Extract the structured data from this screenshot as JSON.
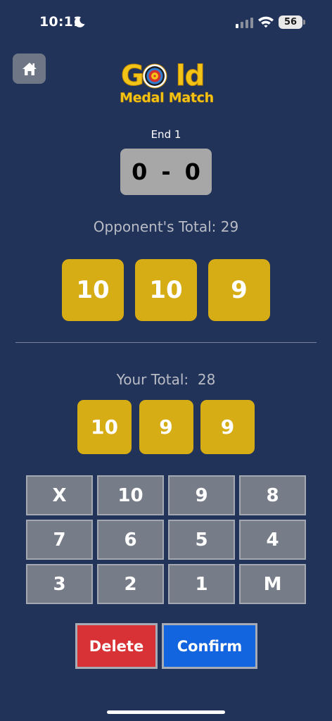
{
  "status_bar": {
    "time": "10:11",
    "battery": "56"
  },
  "logo": {
    "line1_a": "G",
    "line1_b": "ld",
    "line2": "Medal Match"
  },
  "match": {
    "end_label": "End 1",
    "score_left": "0",
    "score_sep": "-",
    "score_right": "0"
  },
  "opponent": {
    "total_label": "Opponent's Total: 29",
    "arrows": [
      "10",
      "10",
      "9"
    ]
  },
  "you": {
    "total_label": "Your Total:  28",
    "arrows": [
      "10",
      "9",
      "9"
    ]
  },
  "keypad": {
    "keys": [
      "X",
      "10",
      "9",
      "8",
      "7",
      "6",
      "5",
      "4",
      "3",
      "2",
      "1",
      "M"
    ]
  },
  "actions": {
    "delete_label": "Delete",
    "confirm_label": "Confirm"
  },
  "colors": {
    "background": "#22335a",
    "arrow_gold": "#d6ad15",
    "key_gray": "#767c88",
    "delete_red": "#d83236",
    "confirm_blue": "#1265de"
  }
}
